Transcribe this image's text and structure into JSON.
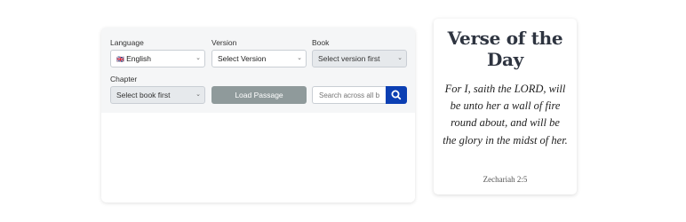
{
  "reader": {
    "language_label": "Language",
    "language_flag": "🇬🇧",
    "language_value": "English",
    "version_label": "Version",
    "version_value": "Select Version",
    "book_label": "Book",
    "book_value": "Select version first",
    "chapter_label": "Chapter",
    "chapter_value": "Select book first",
    "load_button": "Load Passage",
    "search_placeholder": "Search across all b",
    "search_icon": "search-icon",
    "accent_color": "#0b3fb3"
  },
  "verse_of_the_day": {
    "title": "Verse of the Day",
    "text": "For I, saith the LORD, will be unto her a wall of fire round about, and will be the glory in the midst of her.",
    "reference": "Zechariah 2:5"
  }
}
